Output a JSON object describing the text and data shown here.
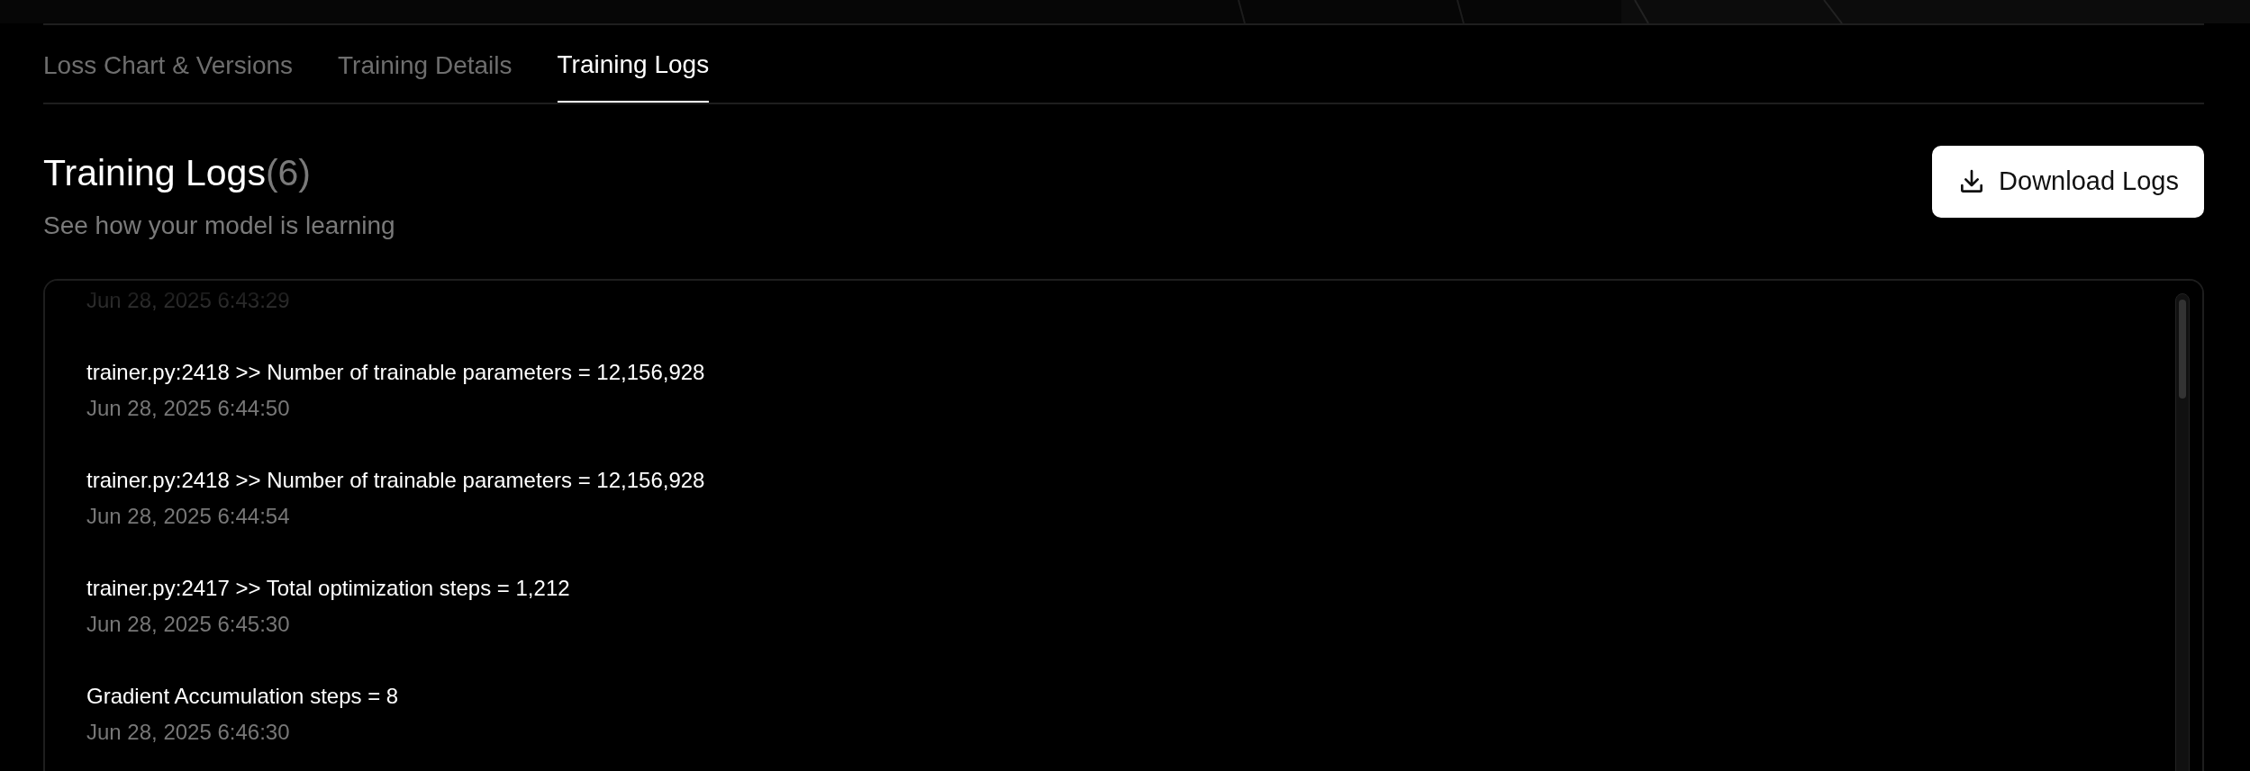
{
  "tabs": [
    {
      "label": "Loss Chart & Versions",
      "selected": false
    },
    {
      "label": "Training Details",
      "selected": false
    },
    {
      "label": "Training Logs",
      "selected": true
    }
  ],
  "header": {
    "title": "Training Logs",
    "count": "(6)",
    "subtitle": "See how your model is learning"
  },
  "download_button": {
    "label": "Download Logs"
  },
  "logs": [
    {
      "timestamp": "Jun 28, 2025 6:43:29"
    },
    {
      "message": "trainer.py:2418 >> Number of trainable parameters = 12,156,928",
      "timestamp": "Jun 28, 2025 6:44:50"
    },
    {
      "message": "trainer.py:2418 >> Number of trainable parameters = 12,156,928",
      "timestamp": "Jun 28, 2025 6:44:54"
    },
    {
      "message": "trainer.py:2417 >> Total optimization steps = 1,212",
      "timestamp": "Jun 28, 2025 6:45:30"
    },
    {
      "message": "Gradient Accumulation steps = 8",
      "timestamp": "Jun 28, 2025 6:46:30"
    }
  ]
}
